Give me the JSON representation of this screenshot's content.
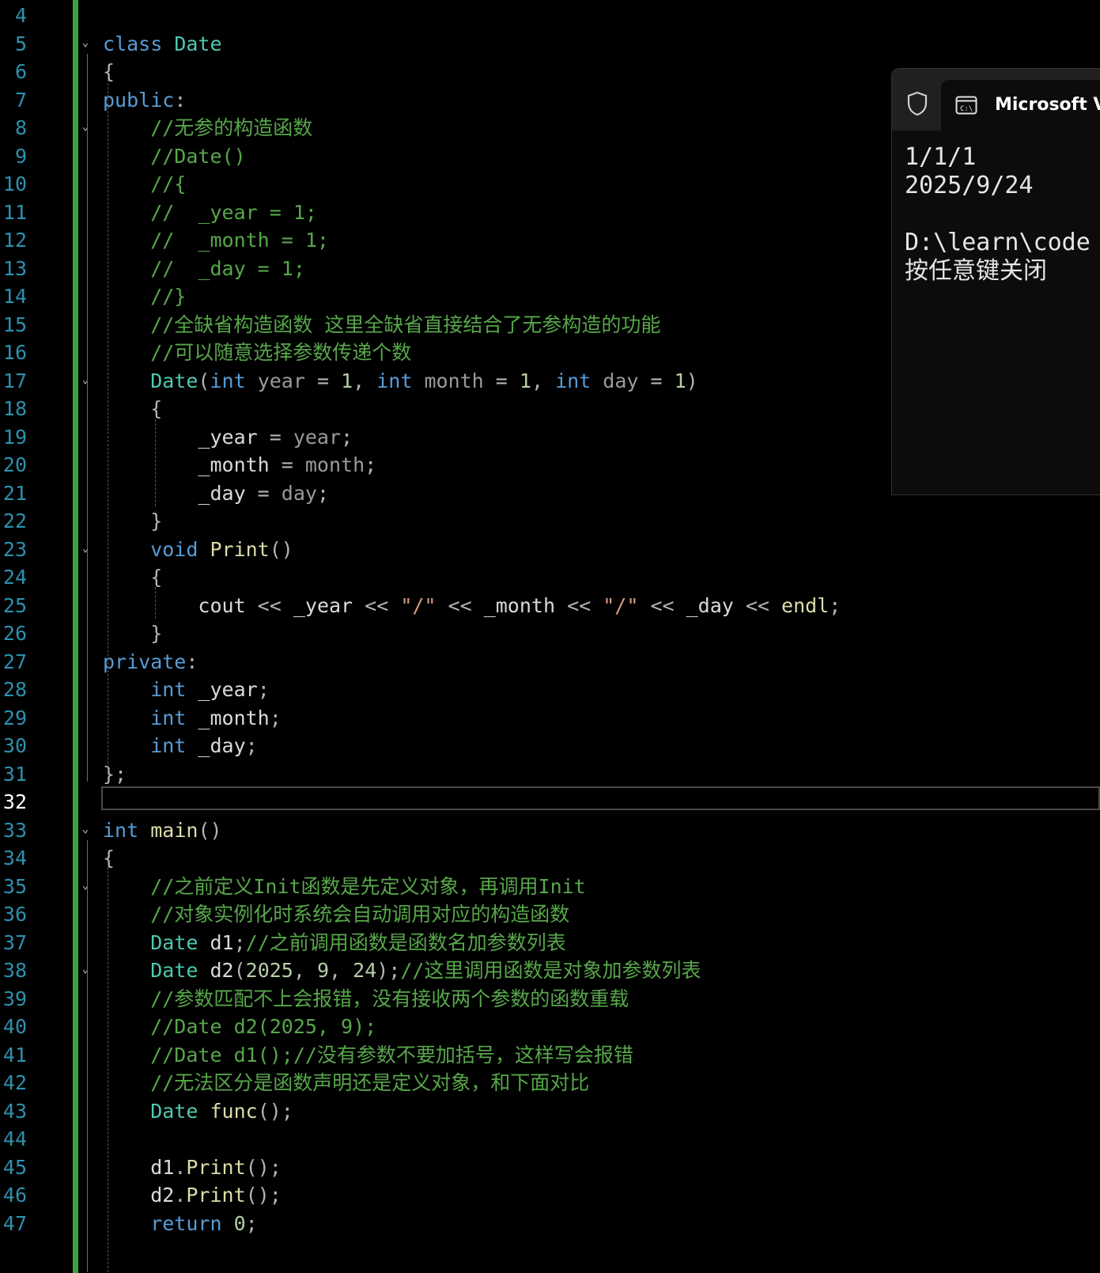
{
  "editor": {
    "current_line": 32,
    "lines": [
      {
        "n": "4",
        "tokens": []
      },
      {
        "n": "5",
        "fold": true,
        "tokens": [
          {
            "c": "kw",
            "t": "class "
          },
          {
            "c": "ty",
            "t": "Date"
          }
        ]
      },
      {
        "n": "6",
        "tokens": [
          {
            "c": "op",
            "t": "{"
          }
        ]
      },
      {
        "n": "7",
        "tokens": [
          {
            "c": "kw",
            "t": "public"
          },
          {
            "c": "op",
            "t": ":"
          }
        ]
      },
      {
        "n": "8",
        "fold": true,
        "tokens": [
          {
            "c": "cm",
            "t": "    //无参的构造函数"
          }
        ]
      },
      {
        "n": "9",
        "tokens": [
          {
            "c": "cm",
            "t": "    //Date()"
          }
        ]
      },
      {
        "n": "10",
        "tokens": [
          {
            "c": "cm",
            "t": "    //{"
          }
        ]
      },
      {
        "n": "11",
        "tokens": [
          {
            "c": "cm",
            "t": "    //  _year = 1;"
          }
        ]
      },
      {
        "n": "12",
        "tokens": [
          {
            "c": "cm",
            "t": "    //  _month = 1;"
          }
        ]
      },
      {
        "n": "13",
        "tokens": [
          {
            "c": "cm",
            "t": "    //  _day = 1;"
          }
        ]
      },
      {
        "n": "14",
        "tokens": [
          {
            "c": "cm",
            "t": "    //}"
          }
        ]
      },
      {
        "n": "15",
        "tokens": [
          {
            "c": "cm",
            "t": "    //全缺省构造函数 这里全缺省直接结合了无参构造的功能"
          }
        ]
      },
      {
        "n": "16",
        "tokens": [
          {
            "c": "cm",
            "t": "    //可以随意选择参数传递个数"
          }
        ]
      },
      {
        "n": "17",
        "fold": true,
        "tokens": [
          {
            "c": "ty",
            "t": "    Date"
          },
          {
            "c": "op",
            "t": "("
          },
          {
            "c": "kw",
            "t": "int "
          },
          {
            "c": "pm",
            "t": "year"
          },
          {
            "c": "op",
            "t": " = "
          },
          {
            "c": "nm",
            "t": "1"
          },
          {
            "c": "op",
            "t": ", "
          },
          {
            "c": "kw",
            "t": "int "
          },
          {
            "c": "pm",
            "t": "month"
          },
          {
            "c": "op",
            "t": " = "
          },
          {
            "c": "nm",
            "t": "1"
          },
          {
            "c": "op",
            "t": ", "
          },
          {
            "c": "kw",
            "t": "int "
          },
          {
            "c": "pm",
            "t": "day"
          },
          {
            "c": "op",
            "t": " = "
          },
          {
            "c": "nm",
            "t": "1"
          },
          {
            "c": "op",
            "t": ")"
          }
        ]
      },
      {
        "n": "18",
        "tokens": [
          {
            "c": "op",
            "t": "    {"
          }
        ]
      },
      {
        "n": "19",
        "tokens": [
          {
            "c": "mb",
            "t": "        _year"
          },
          {
            "c": "op",
            "t": " = "
          },
          {
            "c": "pm",
            "t": "year"
          },
          {
            "c": "op",
            "t": ";"
          }
        ]
      },
      {
        "n": "20",
        "tokens": [
          {
            "c": "mb",
            "t": "        _month"
          },
          {
            "c": "op",
            "t": " = "
          },
          {
            "c": "pm",
            "t": "month"
          },
          {
            "c": "op",
            "t": ";"
          }
        ]
      },
      {
        "n": "21",
        "tokens": [
          {
            "c": "mb",
            "t": "        _day"
          },
          {
            "c": "op",
            "t": " = "
          },
          {
            "c": "pm",
            "t": "day"
          },
          {
            "c": "op",
            "t": ";"
          }
        ]
      },
      {
        "n": "22",
        "tokens": [
          {
            "c": "op",
            "t": "    }"
          }
        ]
      },
      {
        "n": "23",
        "fold": true,
        "tokens": [
          {
            "c": "kw",
            "t": "    void "
          },
          {
            "c": "fn",
            "t": "Print"
          },
          {
            "c": "op",
            "t": "()"
          }
        ]
      },
      {
        "n": "24",
        "tokens": [
          {
            "c": "op",
            "t": "    {"
          }
        ]
      },
      {
        "n": "25",
        "tokens": [
          {
            "c": "mb",
            "t": "        cout"
          },
          {
            "c": "op",
            "t": " << "
          },
          {
            "c": "mb",
            "t": "_year"
          },
          {
            "c": "op",
            "t": " << "
          },
          {
            "c": "st",
            "t": "\"/\""
          },
          {
            "c": "op",
            "t": " << "
          },
          {
            "c": "mb",
            "t": "_month"
          },
          {
            "c": "op",
            "t": " << "
          },
          {
            "c": "st",
            "t": "\"/\""
          },
          {
            "c": "op",
            "t": " << "
          },
          {
            "c": "mb",
            "t": "_day"
          },
          {
            "c": "op",
            "t": " << "
          },
          {
            "c": "fn",
            "t": "endl"
          },
          {
            "c": "op",
            "t": ";"
          }
        ]
      },
      {
        "n": "26",
        "tokens": [
          {
            "c": "op",
            "t": "    }"
          }
        ]
      },
      {
        "n": "27",
        "tokens": [
          {
            "c": "kw",
            "t": "private"
          },
          {
            "c": "op",
            "t": ":"
          }
        ]
      },
      {
        "n": "28",
        "tokens": [
          {
            "c": "kw",
            "t": "    int "
          },
          {
            "c": "mb",
            "t": "_year"
          },
          {
            "c": "op",
            "t": ";"
          }
        ]
      },
      {
        "n": "29",
        "tokens": [
          {
            "c": "kw",
            "t": "    int "
          },
          {
            "c": "mb",
            "t": "_month"
          },
          {
            "c": "op",
            "t": ";"
          }
        ]
      },
      {
        "n": "30",
        "tokens": [
          {
            "c": "kw",
            "t": "    int "
          },
          {
            "c": "mb",
            "t": "_day"
          },
          {
            "c": "op",
            "t": ";"
          }
        ]
      },
      {
        "n": "31",
        "tokens": [
          {
            "c": "op",
            "t": "};"
          }
        ]
      },
      {
        "n": "32",
        "tokens": []
      },
      {
        "n": "33",
        "fold": true,
        "tokens": [
          {
            "c": "kw",
            "t": "int "
          },
          {
            "c": "fn",
            "t": "main"
          },
          {
            "c": "op",
            "t": "()"
          }
        ]
      },
      {
        "n": "34",
        "tokens": [
          {
            "c": "op",
            "t": "{"
          }
        ]
      },
      {
        "n": "35",
        "fold": true,
        "tokens": [
          {
            "c": "cm",
            "t": "    //之前定义Init函数是先定义对象，再调用Init"
          }
        ]
      },
      {
        "n": "36",
        "tokens": [
          {
            "c": "cm",
            "t": "    //对象实例化时系统会自动调用对应的构造函数"
          }
        ]
      },
      {
        "n": "37",
        "tokens": [
          {
            "c": "ty",
            "t": "    Date "
          },
          {
            "c": "mb",
            "t": "d1"
          },
          {
            "c": "op",
            "t": ";"
          },
          {
            "c": "cm",
            "t": "//之前调用函数是函数名加参数列表"
          }
        ]
      },
      {
        "n": "38",
        "fold": true,
        "tokens": [
          {
            "c": "ty",
            "t": "    Date "
          },
          {
            "c": "mb",
            "t": "d2"
          },
          {
            "c": "op",
            "t": "("
          },
          {
            "c": "nm",
            "t": "2025"
          },
          {
            "c": "op",
            "t": ", "
          },
          {
            "c": "nm",
            "t": "9"
          },
          {
            "c": "op",
            "t": ", "
          },
          {
            "c": "nm",
            "t": "24"
          },
          {
            "c": "op",
            "t": ");"
          },
          {
            "c": "cm",
            "t": "//这里调用函数是对象加参数列表"
          }
        ]
      },
      {
        "n": "39",
        "tokens": [
          {
            "c": "cm",
            "t": "    //参数匹配不上会报错，没有接收两个参数的函数重载"
          }
        ]
      },
      {
        "n": "40",
        "tokens": [
          {
            "c": "cm",
            "t": "    //Date d2(2025, 9);"
          }
        ]
      },
      {
        "n": "41",
        "tokens": [
          {
            "c": "cm",
            "t": "    //Date d1();//没有参数不要加括号，这样写会报错"
          }
        ]
      },
      {
        "n": "42",
        "tokens": [
          {
            "c": "cm",
            "t": "    //无法区分是函数声明还是定义对象，和下面对比"
          }
        ]
      },
      {
        "n": "43",
        "tokens": [
          {
            "c": "ty",
            "t": "    Date "
          },
          {
            "c": "fn",
            "t": "func"
          },
          {
            "c": "op",
            "t": "();"
          }
        ]
      },
      {
        "n": "44",
        "tokens": []
      },
      {
        "n": "45",
        "tokens": [
          {
            "c": "mb",
            "t": "    d1"
          },
          {
            "c": "op",
            "t": "."
          },
          {
            "c": "fn",
            "t": "Print"
          },
          {
            "c": "op",
            "t": "();"
          }
        ]
      },
      {
        "n": "46",
        "tokens": [
          {
            "c": "mb",
            "t": "    d2"
          },
          {
            "c": "op",
            "t": "."
          },
          {
            "c": "fn",
            "t": "Print"
          },
          {
            "c": "op",
            "t": "();"
          }
        ]
      },
      {
        "n": "47",
        "tokens": [
          {
            "c": "kw",
            "t": "    return "
          },
          {
            "c": "nm",
            "t": "0"
          },
          {
            "c": "op",
            "t": ";"
          }
        ]
      }
    ]
  },
  "console": {
    "tab_title": "Microsoft Visual Studio 调试控制台",
    "shield_icon": "shield-icon",
    "terminal_icon": "terminal-icon",
    "output_lines": [
      "1/1/1",
      "2025/9/24",
      "",
      "D:\\learn\\code",
      "按任意键关闭"
    ]
  },
  "colors": {
    "keyword": "#569cd6",
    "type": "#4ec9b0",
    "comment": "#57a64a",
    "function": "#dcdcaa",
    "line_number": "#2b91af",
    "change_bar": "#3aa13f"
  }
}
